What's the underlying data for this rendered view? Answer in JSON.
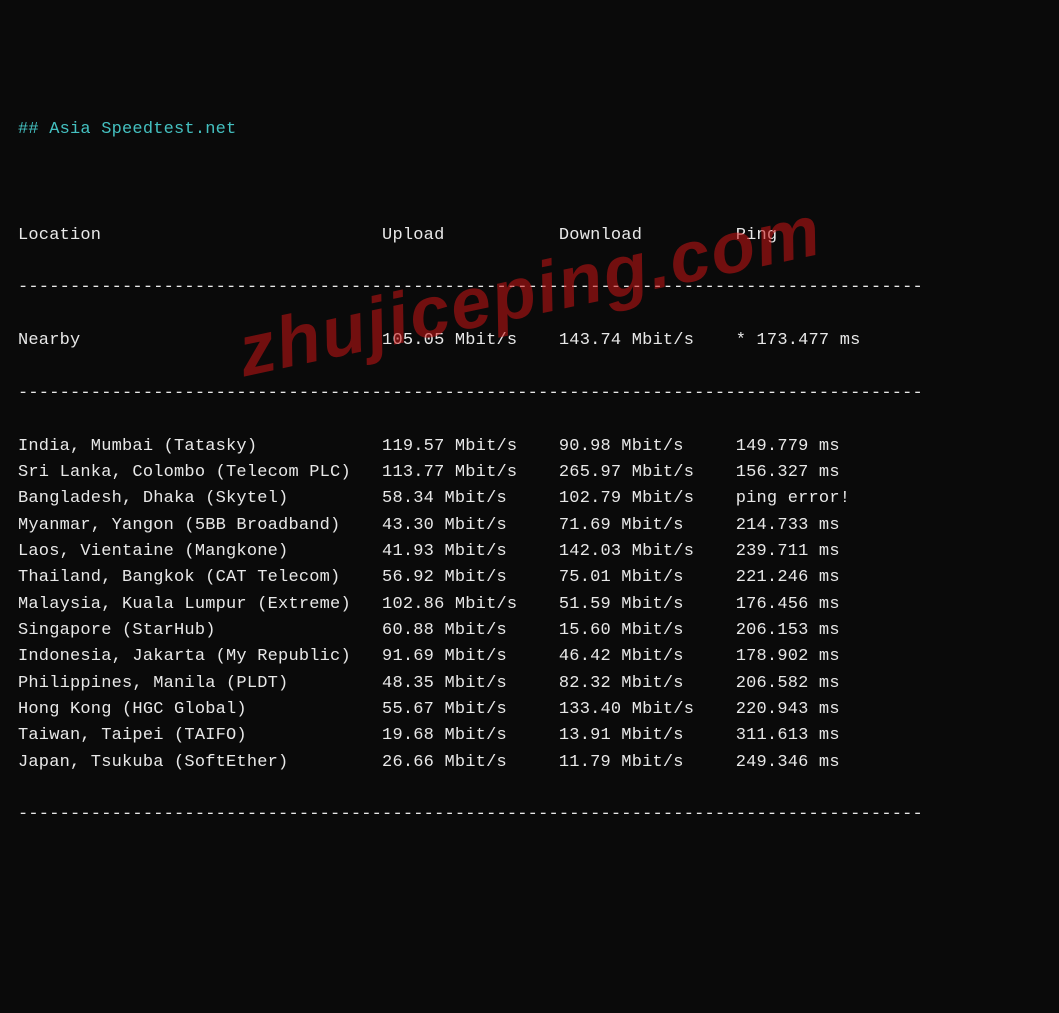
{
  "title_hash": "##",
  "title_text": " Asia Speedtest.net",
  "headers": {
    "location": "Location",
    "upload": "Upload",
    "download": "Download",
    "ping": "Ping"
  },
  "divider_top": "---------------------------------------------------------------------------------------",
  "nearby": {
    "location": "Nearby",
    "upload": "105.05 Mbit/s",
    "download": "143.74 Mbit/s",
    "ping": "* 173.477 ms"
  },
  "divider_mid": "---------------------------------------------------------------------------------------",
  "rows": [
    {
      "location": "India, Mumbai (Tatasky)",
      "upload": "119.57 Mbit/s",
      "download": "90.98 Mbit/s",
      "ping": "149.779 ms"
    },
    {
      "location": "Sri Lanka, Colombo (Telecom PLC)",
      "upload": "113.77 Mbit/s",
      "download": "265.97 Mbit/s",
      "ping": "156.327 ms"
    },
    {
      "location": "Bangladesh, Dhaka (Skytel)",
      "upload": "58.34 Mbit/s",
      "download": "102.79 Mbit/s",
      "ping": "ping error!"
    },
    {
      "location": "Myanmar, Yangon (5BB Broadband)",
      "upload": "43.30 Mbit/s",
      "download": "71.69 Mbit/s",
      "ping": "214.733 ms"
    },
    {
      "location": "Laos, Vientaine (Mangkone)",
      "upload": "41.93 Mbit/s",
      "download": "142.03 Mbit/s",
      "ping": "239.711 ms"
    },
    {
      "location": "Thailand, Bangkok (CAT Telecom)",
      "upload": "56.92 Mbit/s",
      "download": "75.01 Mbit/s",
      "ping": "221.246 ms"
    },
    {
      "location": "Malaysia, Kuala Lumpur (Extreme)",
      "upload": "102.86 Mbit/s",
      "download": "51.59 Mbit/s",
      "ping": "176.456 ms"
    },
    {
      "location": "Singapore (StarHub)",
      "upload": "60.88 Mbit/s",
      "download": "15.60 Mbit/s",
      "ping": "206.153 ms"
    },
    {
      "location": "Indonesia, Jakarta (My Republic)",
      "upload": "91.69 Mbit/s",
      "download": "46.42 Mbit/s",
      "ping": "178.902 ms"
    },
    {
      "location": "Philippines, Manila (PLDT)",
      "upload": "48.35 Mbit/s",
      "download": "82.32 Mbit/s",
      "ping": "206.582 ms"
    },
    {
      "location": "Hong Kong (HGC Global)",
      "upload": "55.67 Mbit/s",
      "download": "133.40 Mbit/s",
      "ping": "220.943 ms"
    },
    {
      "location": "Taiwan, Taipei (TAIFO)",
      "upload": "19.68 Mbit/s",
      "download": "13.91 Mbit/s",
      "ping": "311.613 ms"
    },
    {
      "location": "Japan, Tsukuba (SoftEther)",
      "upload": "26.66 Mbit/s",
      "download": "11.79 Mbit/s",
      "ping": "249.346 ms"
    }
  ],
  "divider_bot": "---------------------------------------------------------------------------------------",
  "watermark": "zhujiceping.com",
  "chart_data": {
    "type": "table",
    "title": "Asia Speedtest.net",
    "columns": [
      "Location",
      "Upload",
      "Download",
      "Ping"
    ],
    "rows": [
      [
        "Nearby",
        "105.05 Mbit/s",
        "143.74 Mbit/s",
        "* 173.477 ms"
      ],
      [
        "India, Mumbai (Tatasky)",
        "119.57 Mbit/s",
        "90.98 Mbit/s",
        "149.779 ms"
      ],
      [
        "Sri Lanka, Colombo (Telecom PLC)",
        "113.77 Mbit/s",
        "265.97 Mbit/s",
        "156.327 ms"
      ],
      [
        "Bangladesh, Dhaka (Skytel)",
        "58.34 Mbit/s",
        "102.79 Mbit/s",
        "ping error!"
      ],
      [
        "Myanmar, Yangon (5BB Broadband)",
        "43.30 Mbit/s",
        "71.69 Mbit/s",
        "214.733 ms"
      ],
      [
        "Laos, Vientaine (Mangkone)",
        "41.93 Mbit/s",
        "142.03 Mbit/s",
        "239.711 ms"
      ],
      [
        "Thailand, Bangkok (CAT Telecom)",
        "56.92 Mbit/s",
        "75.01 Mbit/s",
        "221.246 ms"
      ],
      [
        "Malaysia, Kuala Lumpur (Extreme)",
        "102.86 Mbit/s",
        "51.59 Mbit/s",
        "176.456 ms"
      ],
      [
        "Singapore (StarHub)",
        "60.88 Mbit/s",
        "15.60 Mbit/s",
        "206.153 ms"
      ],
      [
        "Indonesia, Jakarta (My Republic)",
        "91.69 Mbit/s",
        "46.42 Mbit/s",
        "178.902 ms"
      ],
      [
        "Philippines, Manila (PLDT)",
        "48.35 Mbit/s",
        "82.32 Mbit/s",
        "206.582 ms"
      ],
      [
        "Hong Kong (HGC Global)",
        "55.67 Mbit/s",
        "133.40 Mbit/s",
        "220.943 ms"
      ],
      [
        "Taiwan, Taipei (TAIFO)",
        "19.68 Mbit/s",
        "13.91 Mbit/s",
        "311.613 ms"
      ],
      [
        "Japan, Tsukuba (SoftEther)",
        "26.66 Mbit/s",
        "11.79 Mbit/s",
        "249.346 ms"
      ]
    ]
  }
}
